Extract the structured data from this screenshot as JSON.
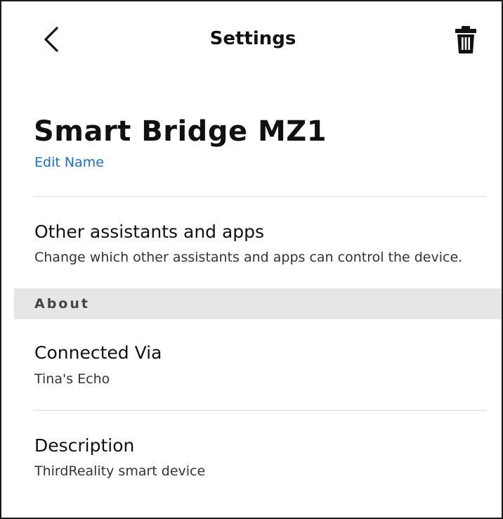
{
  "header": {
    "title": "Settings",
    "back_icon": "chevron-left-icon",
    "delete_icon": "trash-icon"
  },
  "device": {
    "name": "Smart Bridge MZ1",
    "edit_label": "Edit Name"
  },
  "other_assistants": {
    "title": "Other assistants and apps",
    "subtitle": "Change which other assistants and apps can control the device."
  },
  "about_section": {
    "label": "About"
  },
  "connected_via": {
    "title": "Connected Via",
    "value": "Tina's Echo"
  },
  "description": {
    "title": "Description",
    "value": "ThirdReality smart device"
  },
  "colors": {
    "link": "#1f6fb2",
    "section_band": "#e6e6e6",
    "divider": "#d9d9d9"
  }
}
